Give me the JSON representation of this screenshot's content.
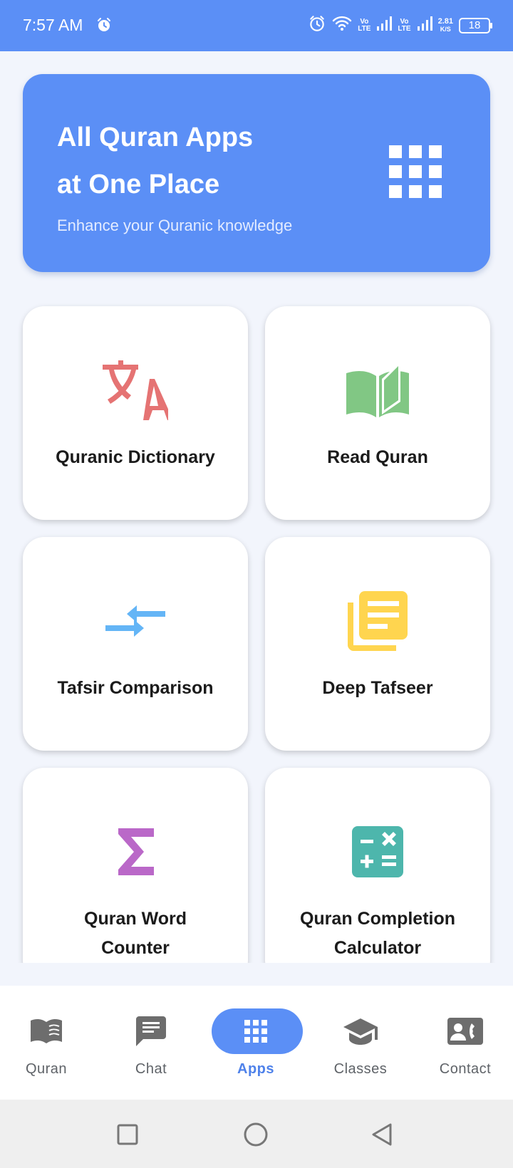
{
  "status_bar": {
    "time": "7:57 AM",
    "net1": [
      "Vo",
      "LTE"
    ],
    "net2": [
      "Vo",
      "LTE"
    ],
    "speed_value": "2.81",
    "speed_unit": "K/S",
    "battery": "18",
    "icons": [
      "alarm-icon",
      "wifi-icon",
      "signal-icon",
      "battery-icon"
    ]
  },
  "hero": {
    "title_line1": "All Quran Apps",
    "title_line2": "at One Place",
    "subtitle": "Enhance your Quranic knowledge",
    "icon": "apps-grid-icon"
  },
  "apps": [
    {
      "label": "Quranic Dictionary",
      "icon": "translate-icon",
      "color": "#e57373"
    },
    {
      "label": "Read Quran",
      "icon": "open-book-icon",
      "color": "#81c784"
    },
    {
      "label": "Tafsir Comparison",
      "icon": "compare-arrows-icon",
      "color": "#64b5f6"
    },
    {
      "label": "Deep Tafseer",
      "icon": "library-books-icon",
      "color": "#ffd54f"
    },
    {
      "label_line1": "Quran Word",
      "label_line2": "Counter",
      "icon": "sigma-icon",
      "color": "#ba68c8"
    },
    {
      "label_line1": "Quran Completion",
      "label_line2": "Calculator",
      "icon": "calculator-icon",
      "color": "#4db6ac"
    }
  ],
  "nav": {
    "items": [
      {
        "label": "Quran",
        "icon": "book-icon",
        "active": false
      },
      {
        "label": "Chat",
        "icon": "chat-icon",
        "active": false
      },
      {
        "label": "Apps",
        "icon": "apps-icon",
        "active": true
      },
      {
        "label": "Classes",
        "icon": "school-icon",
        "active": false
      },
      {
        "label": "Contact",
        "icon": "contact-phone-icon",
        "active": false
      }
    ]
  },
  "colors": {
    "primary": "#5b8ff6",
    "background": "#f2f5fc",
    "nav_inactive": "#5f6368"
  }
}
